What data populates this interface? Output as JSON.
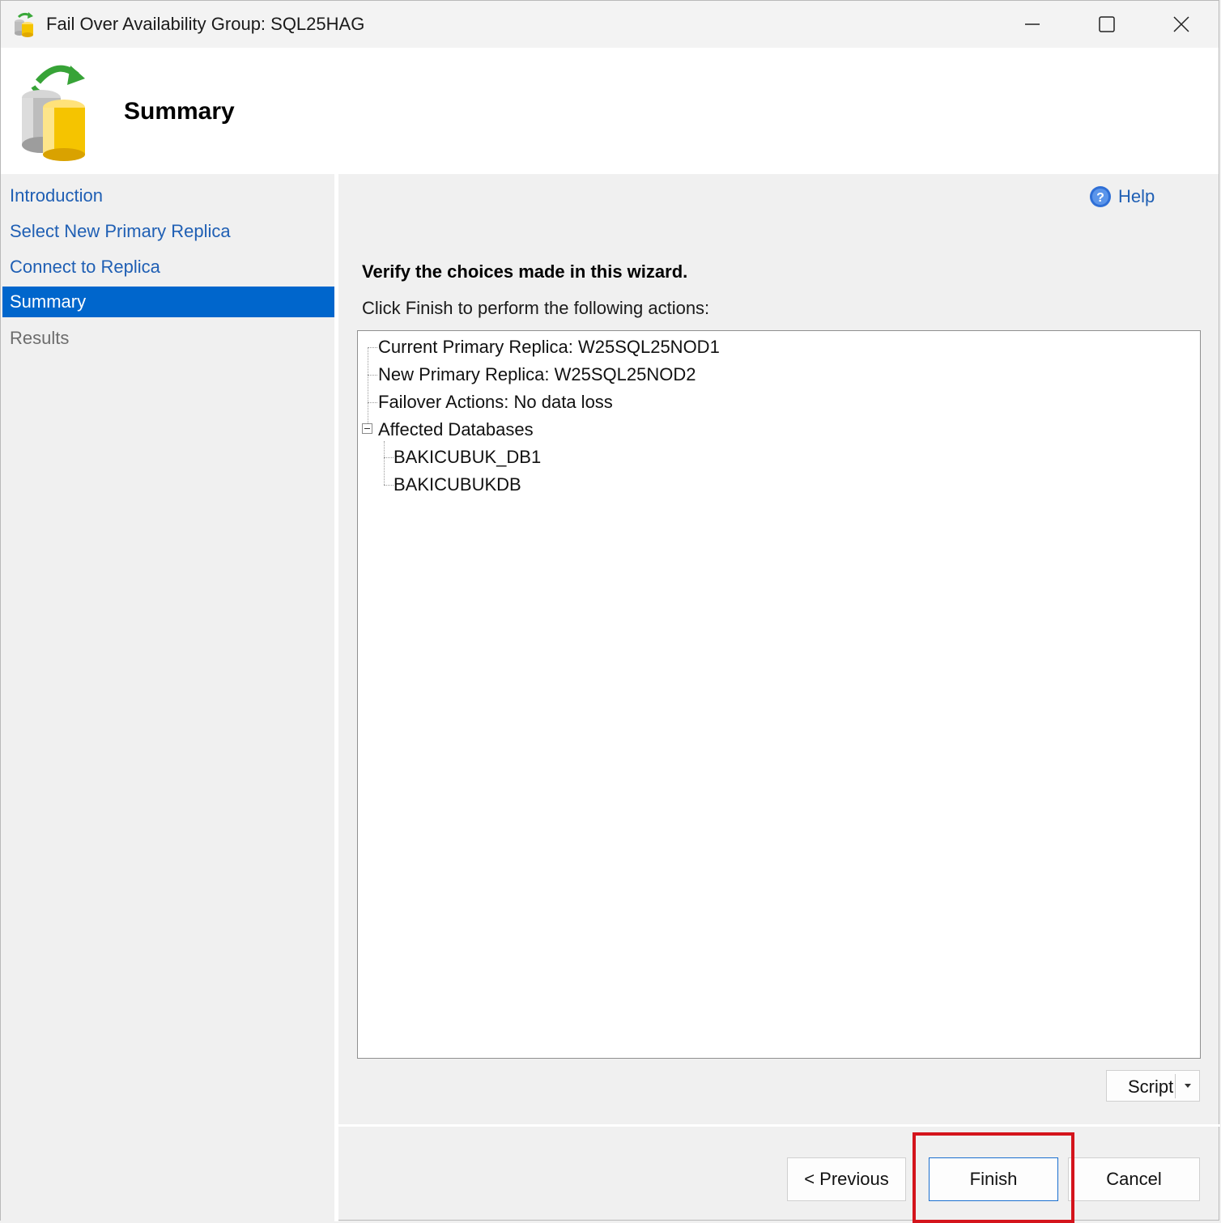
{
  "window": {
    "title": "Fail Over Availability Group: SQL25HAG",
    "controls": {
      "minimize": "minimize",
      "maximize": "maximize",
      "close": "close"
    }
  },
  "header": {
    "title": "Summary"
  },
  "nav": {
    "items": [
      {
        "label": "Introduction",
        "state": "link"
      },
      {
        "label": "Select New Primary Replica",
        "state": "link"
      },
      {
        "label": "Connect to Replica",
        "state": "link"
      },
      {
        "label": "Summary",
        "state": "active"
      },
      {
        "label": "Results",
        "state": "disabled"
      }
    ]
  },
  "content": {
    "help_label": "Help",
    "heading": "Verify the choices made in this wizard.",
    "subheading": "Click Finish to perform the following actions:",
    "tree": {
      "nodes": [
        "Current Primary Replica: W25SQL25NOD1",
        "New Primary Replica: W25SQL25NOD2",
        "Failover Actions: No data loss",
        "Affected Databases"
      ],
      "affected_databases": [
        "BAKICUBUK_DB1",
        "BAKICUBUKDB"
      ]
    },
    "script_label": "Script"
  },
  "footer": {
    "previous_label": "< Previous",
    "finish_label": "Finish",
    "cancel_label": "Cancel"
  },
  "colors": {
    "accent": "#0066cc",
    "link": "#1f5fb4",
    "highlight": "#d4141c"
  },
  "icons": {
    "title": "availability-group-icon",
    "header": "database-failover-icon",
    "help": "help-icon"
  }
}
